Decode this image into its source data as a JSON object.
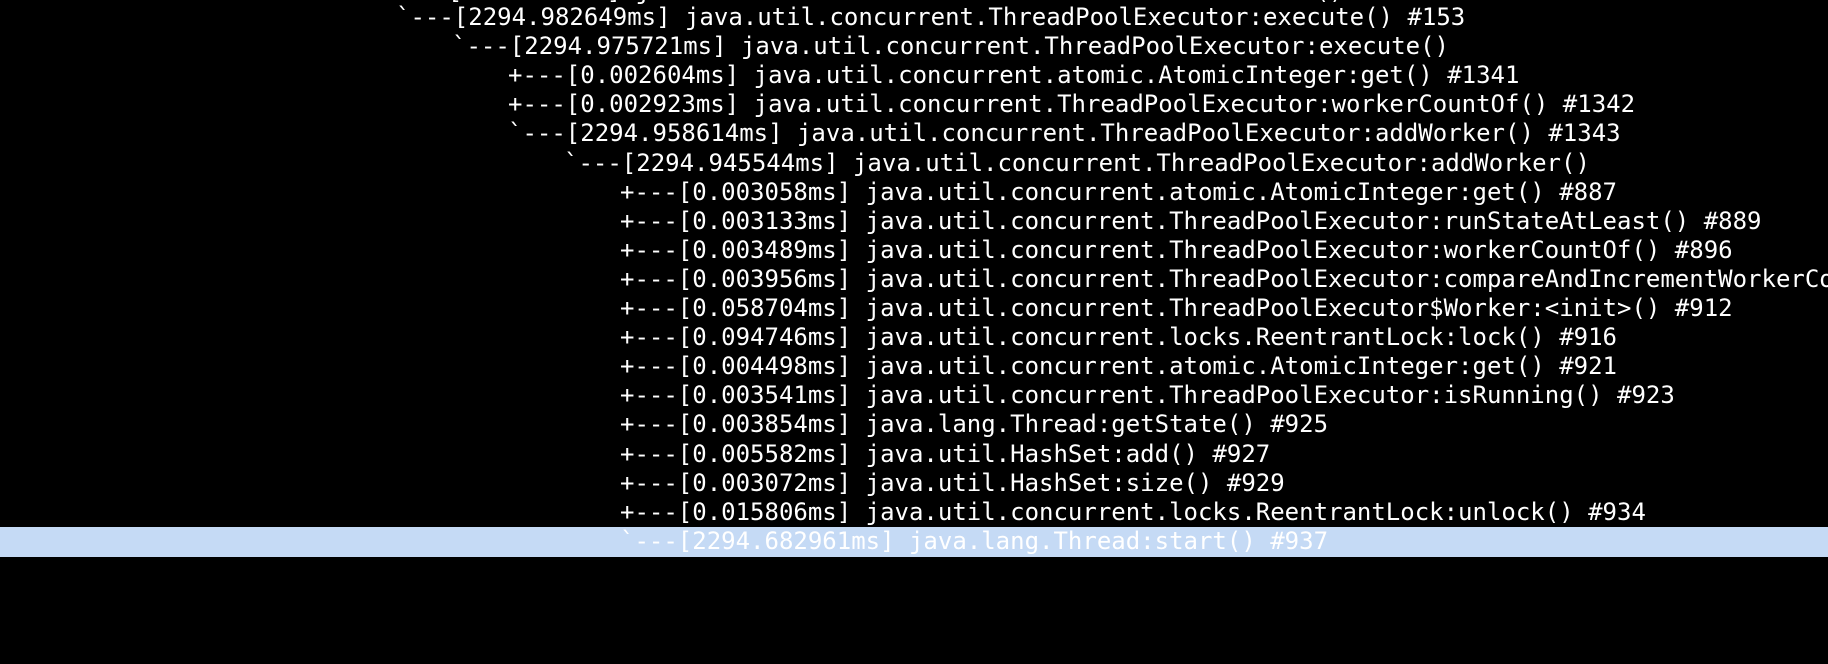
{
  "terminal": {
    "top_clipped_text": "`---[2294.98...] java.util.concurrent.ThreadPoolExecutor:execute()",
    "lines": [
      {
        "indent": 0,
        "text": "`---[2294.982649ms] java.util.concurrent.ThreadPoolExecutor:execute() #153"
      },
      {
        "indent": 1,
        "text": "`---[2294.975721ms] java.util.concurrent.ThreadPoolExecutor:execute()"
      },
      {
        "indent": 2,
        "text": "+---[0.002604ms] java.util.concurrent.atomic.AtomicInteger:get() #1341"
      },
      {
        "indent": 2,
        "text": "+---[0.002923ms] java.util.concurrent.ThreadPoolExecutor:workerCountOf() #1342"
      },
      {
        "indent": 2,
        "text": "`---[2294.958614ms] java.util.concurrent.ThreadPoolExecutor:addWorker() #1343"
      },
      {
        "indent": 3,
        "text": "`---[2294.945544ms] java.util.concurrent.ThreadPoolExecutor:addWorker()"
      },
      {
        "indent": 4,
        "text": "+---[0.003058ms] java.util.concurrent.atomic.AtomicInteger:get() #887"
      },
      {
        "indent": 4,
        "text": "+---[0.003133ms] java.util.concurrent.ThreadPoolExecutor:runStateAtLeast() #889"
      },
      {
        "indent": 4,
        "text": "+---[0.003489ms] java.util.concurrent.ThreadPoolExecutor:workerCountOf() #896"
      },
      {
        "indent": 4,
        "text": "+---[0.003956ms] java.util.concurrent.ThreadPoolExecutor:compareAndIncrementWorkerCount"
      },
      {
        "indent": 4,
        "text": "+---[0.058704ms] java.util.concurrent.ThreadPoolExecutor$Worker:<init>() #912"
      },
      {
        "indent": 4,
        "text": "+---[0.094746ms] java.util.concurrent.locks.ReentrantLock:lock() #916"
      },
      {
        "indent": 4,
        "text": "+---[0.004498ms] java.util.concurrent.atomic.AtomicInteger:get() #921"
      },
      {
        "indent": 4,
        "text": "+---[0.003541ms] java.util.concurrent.ThreadPoolExecutor:isRunning() #923"
      },
      {
        "indent": 4,
        "text": "+---[0.003854ms] java.lang.Thread:getState() #925"
      },
      {
        "indent": 4,
        "text": "+---[0.005582ms] java.util.HashSet:add() #927"
      },
      {
        "indent": 4,
        "text": "+---[0.003072ms] java.util.HashSet:size() #929"
      },
      {
        "indent": 4,
        "text": "+---[0.015806ms] java.util.concurrent.locks.ReentrantLock:unlock() #934"
      },
      {
        "indent": 4,
        "text": "`---[2294.682961ms] java.lang.Thread:start() #937",
        "selected": true
      }
    ],
    "colors": {
      "background": "#000000",
      "foreground": "#ffffff",
      "selection": "#c5daf5"
    }
  }
}
